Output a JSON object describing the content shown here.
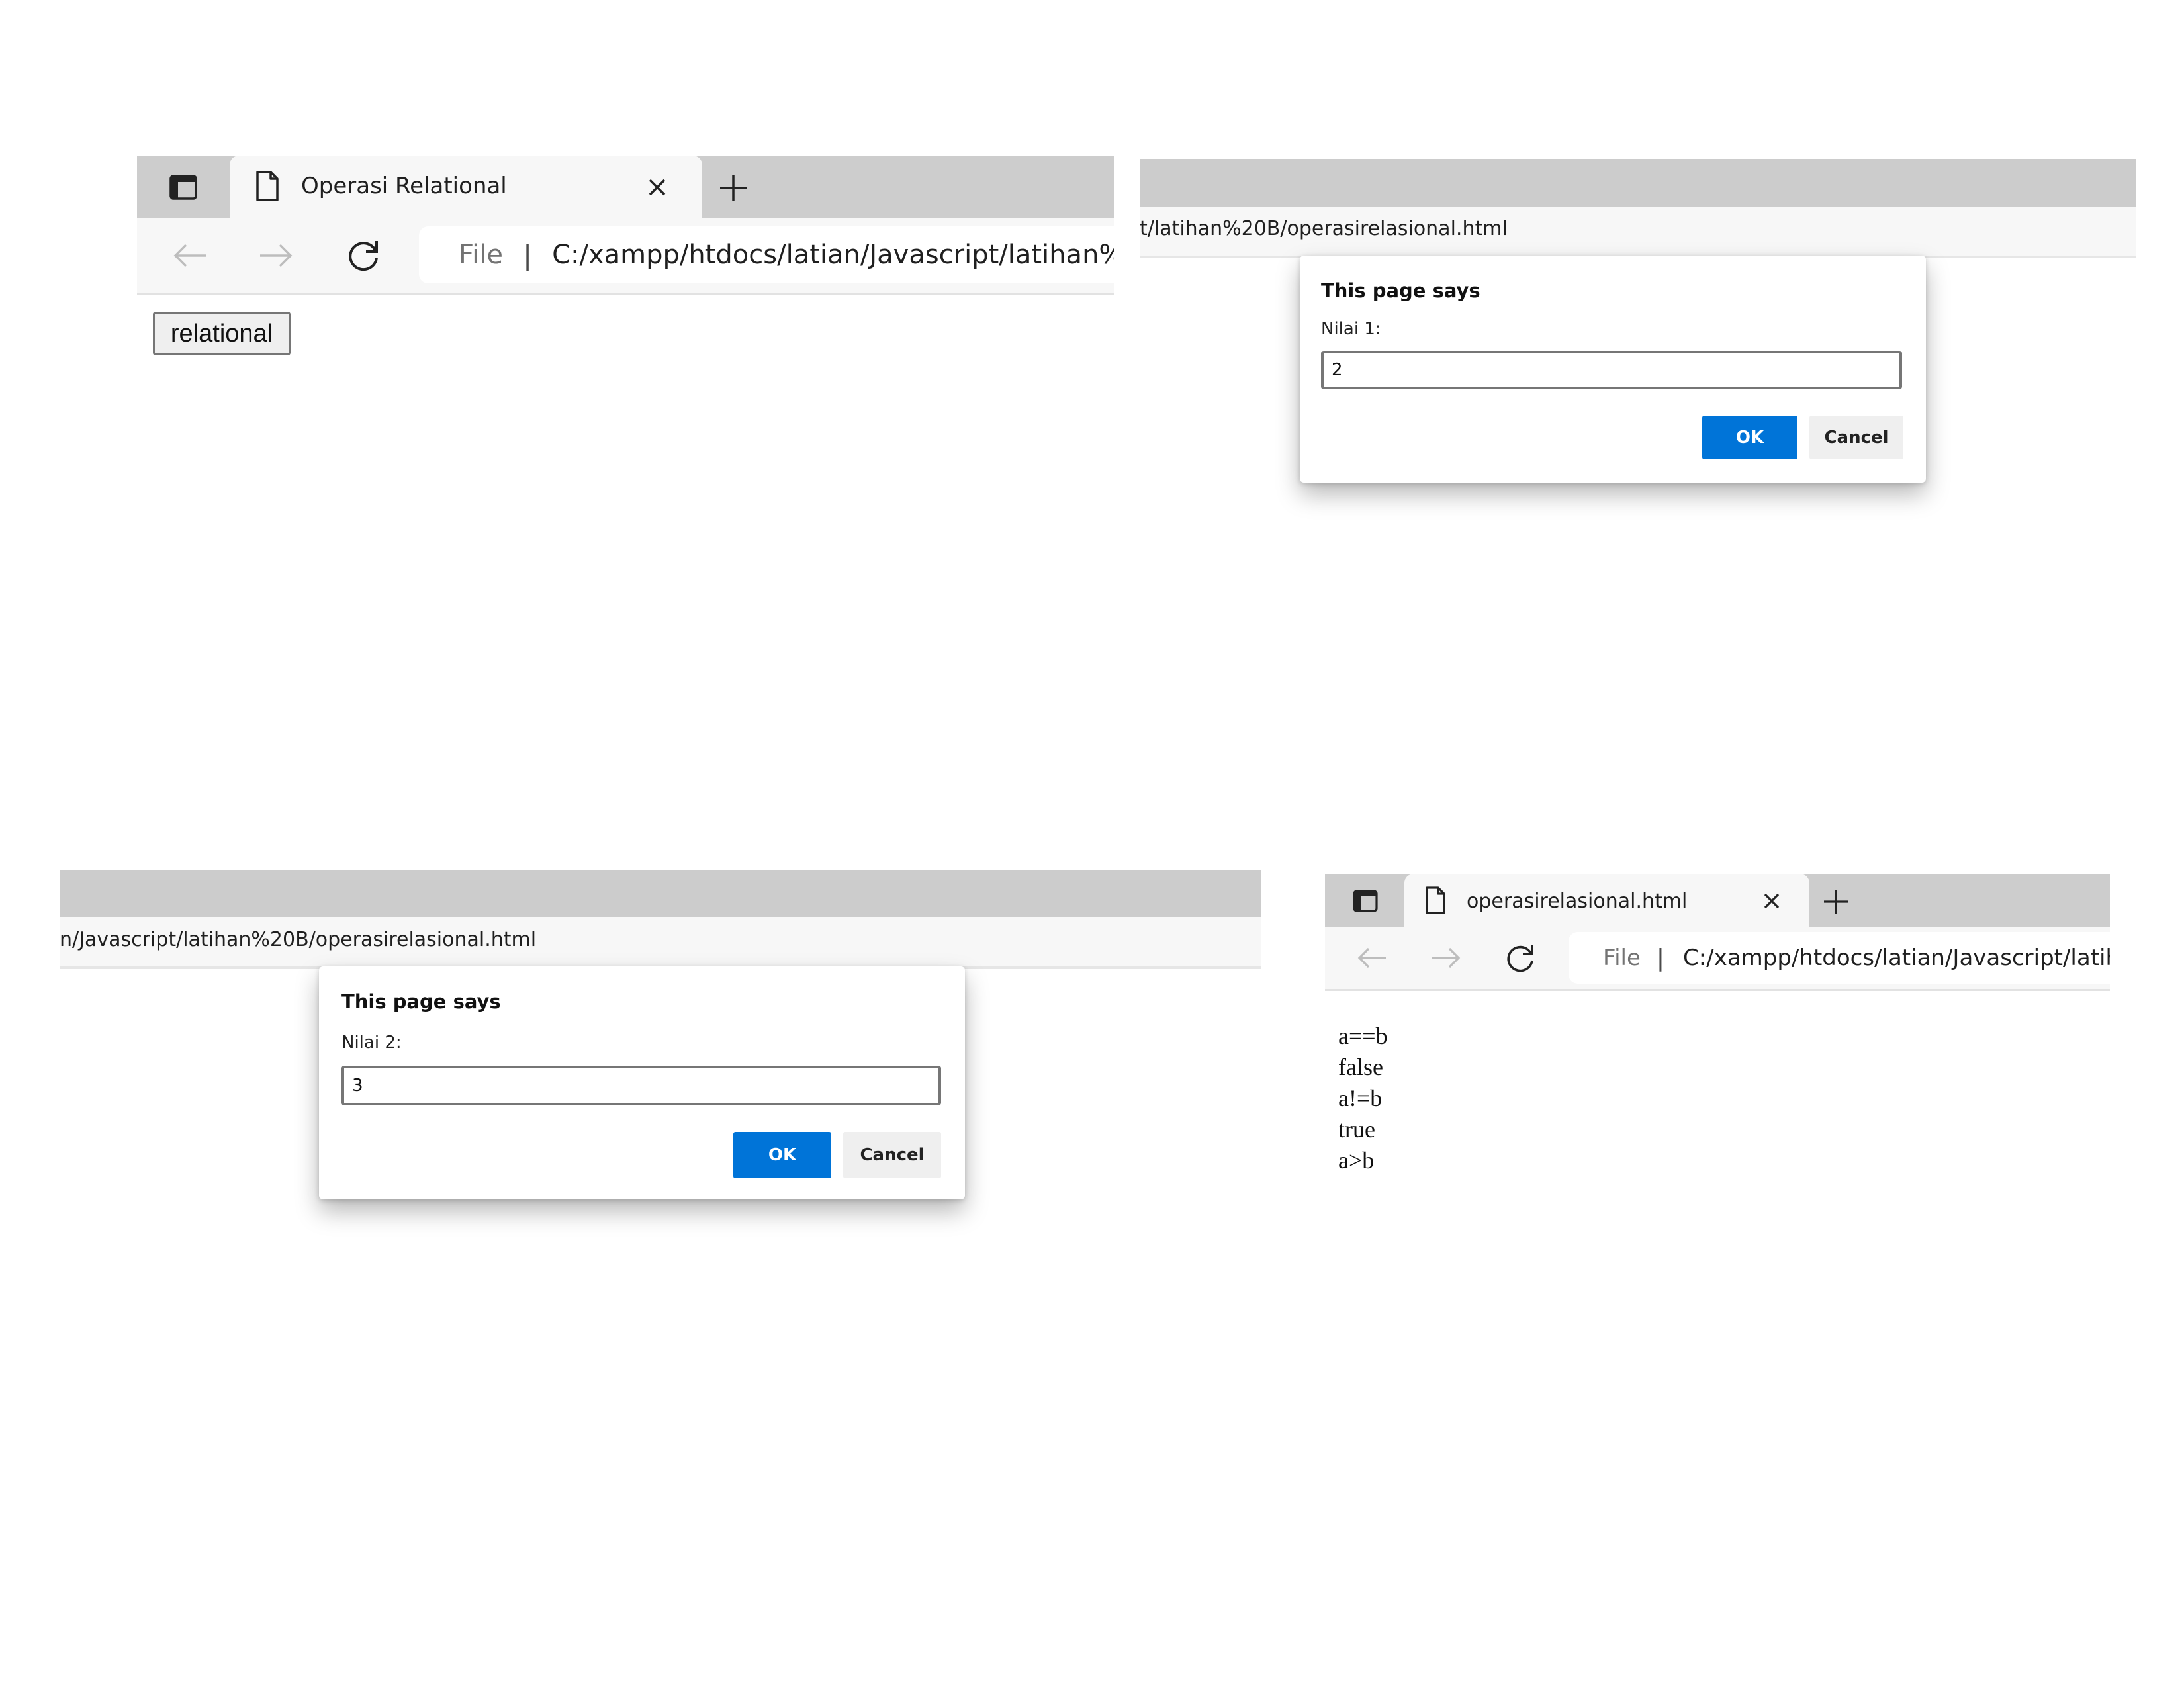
{
  "colors": {
    "chrome_gray": "#cdcdcd",
    "toolbar": "#f7f7f7",
    "accent_blue": "#0074d8",
    "cancel_gray": "#efefef"
  },
  "panel1": {
    "tab": {
      "title": "Operasi Relational",
      "icon": "page-icon"
    },
    "address": {
      "scheme_label": "File",
      "separator": "|",
      "url": "C:/xampp/htdocs/latian/Javascript/latihan%2"
    },
    "page": {
      "button_label": "relational"
    }
  },
  "panel2": {
    "url_partial": "t/latihan%20B/operasirelasional.html",
    "dialog": {
      "title": "This page says",
      "label": "Nilai 1:",
      "value": "2",
      "ok": "OK",
      "cancel": "Cancel"
    }
  },
  "panel3": {
    "url_partial": "n/Javascript/latihan%20B/operasirelasional.html",
    "dialog": {
      "title": "This page says",
      "label": "Nilai 2:",
      "value": "3",
      "ok": "OK",
      "cancel": "Cancel"
    }
  },
  "panel4": {
    "tab": {
      "title": "operasirelasional.html",
      "icon": "page-icon"
    },
    "address": {
      "scheme_label": "File",
      "separator": "|",
      "url": "C:/xampp/htdocs/latian/Javascript/latih"
    },
    "output": [
      "a==b",
      "false",
      "a!=b",
      "true",
      "a>b"
    ]
  }
}
